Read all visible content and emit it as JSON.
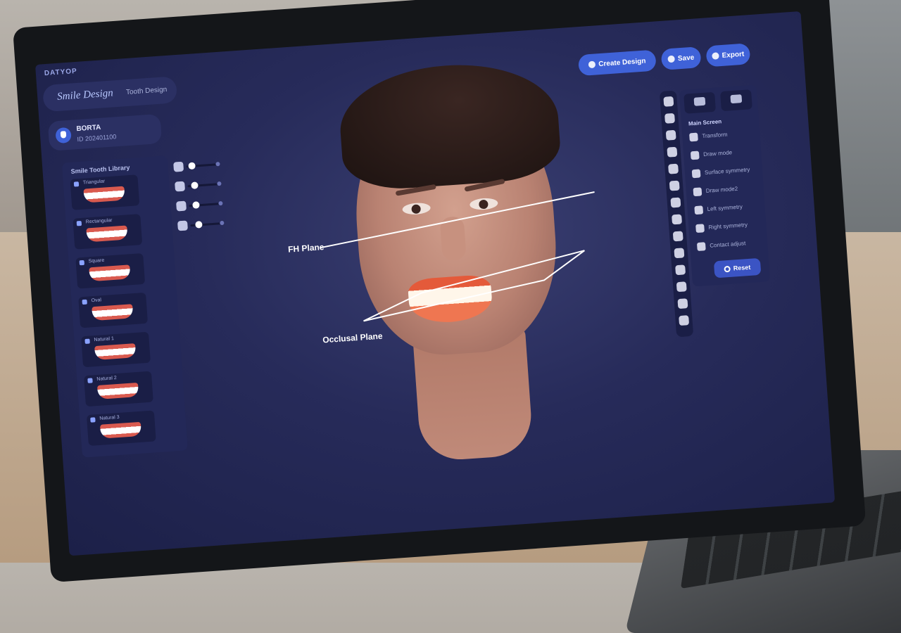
{
  "app": {
    "brand": "DATYOP"
  },
  "tabs": [
    {
      "label": "Smile Design"
    },
    {
      "label": "Tooth Design"
    }
  ],
  "patient": {
    "name": "BORTA",
    "id": "ID 202401100"
  },
  "library": {
    "title": "Smile Tooth Library",
    "items": [
      {
        "label": "Triangular"
      },
      {
        "label": "Rectangular"
      },
      {
        "label": "Square"
      },
      {
        "label": "Oval"
      },
      {
        "label": "Natural 1"
      },
      {
        "label": "Natural 2"
      },
      {
        "label": "Natural 3"
      }
    ]
  },
  "sliders": [
    {
      "icon": "tooth-icon",
      "level": 0.1
    },
    {
      "icon": "arch-icon",
      "level": 0.15
    },
    {
      "icon": "teeth-row-icon",
      "level": 0.15
    },
    {
      "icon": "gum-icon",
      "level": 0.2
    }
  ],
  "overlay": {
    "fh_plane": "FH Plane",
    "occlusal_plane": "Occlusal Plane"
  },
  "toolbar": {
    "create_design": "Create Design",
    "save": "Save",
    "export": "Export"
  },
  "side_panel": {
    "title": "Main Screen",
    "items": [
      {
        "label": "Transform"
      },
      {
        "label": "Draw mode"
      },
      {
        "label": "Surface symmetry"
      },
      {
        "label": "Draw mode2"
      },
      {
        "label": "Left symmetry"
      },
      {
        "label": "Right symmetry"
      },
      {
        "label": "Contact adjust"
      }
    ],
    "reset": "Reset"
  },
  "colors": {
    "accent": "#3f62d8",
    "background": "#272b5a",
    "panel": "#232858"
  }
}
